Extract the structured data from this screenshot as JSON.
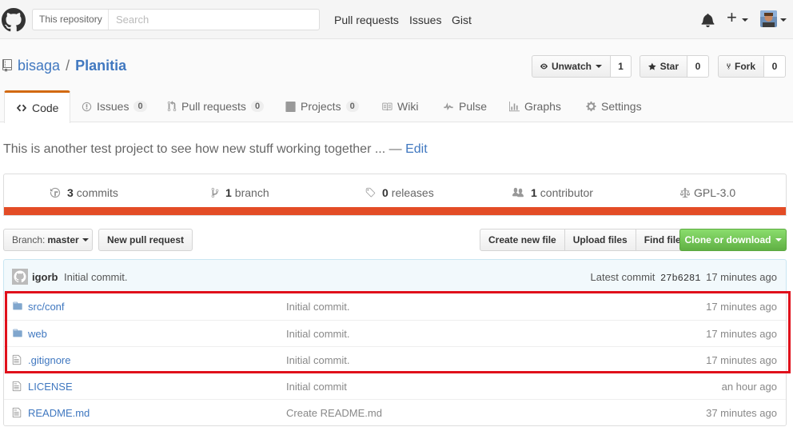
{
  "header": {
    "search_scope": "This repository",
    "search_placeholder": "Search",
    "nav": [
      "Pull requests",
      "Issues",
      "Gist"
    ],
    "icons": [
      "github-logo-icon",
      "bell-icon",
      "plus-icon",
      "avatar"
    ]
  },
  "repo": {
    "owner": "bisaga",
    "separator": "/",
    "name": "Planitia",
    "watch_label": "Unwatch",
    "watch_count": "1",
    "star_label": "Star",
    "star_count": "0",
    "fork_label": "Fork",
    "fork_count": "0"
  },
  "tabs": [
    {
      "label": "Code",
      "counter": null,
      "selected": true
    },
    {
      "label": "Issues",
      "counter": "0"
    },
    {
      "label": "Pull requests",
      "counter": "0"
    },
    {
      "label": "Projects",
      "counter": "0"
    },
    {
      "label": "Wiki",
      "counter": null
    },
    {
      "label": "Pulse",
      "counter": null
    },
    {
      "label": "Graphs",
      "counter": null
    },
    {
      "label": "Settings",
      "counter": null
    }
  ],
  "description": {
    "text": "This is another test project to see how new stuff working together ... —",
    "edit_label": "Edit"
  },
  "summary": {
    "commits_count": "3",
    "commits_label": "commits",
    "branch_count": "1",
    "branch_label": "branch",
    "releases_count": "0",
    "releases_label": "releases",
    "contributor_count": "1",
    "contributor_label": "contributor",
    "license": "GPL-3.0",
    "language_color": "#e34c26"
  },
  "file_nav": {
    "branch_prefix": "Branch:",
    "branch_name": "master",
    "new_pull_request": "New pull request",
    "create_new_file": "Create new file",
    "upload_files": "Upload files",
    "find_file": "Find file",
    "clone_download": "Clone or download"
  },
  "commit_tease": {
    "author": "igorb",
    "message": "Initial commit.",
    "latest_label": "Latest commit",
    "sha": "27b6281",
    "age": "17 minutes ago"
  },
  "files": [
    {
      "type": "dir",
      "name": "src/conf",
      "message": "Initial commit.",
      "age": "17 minutes ago"
    },
    {
      "type": "dir",
      "name": "web",
      "message": "Initial commit.",
      "age": "17 minutes ago"
    },
    {
      "type": "file",
      "name": ".gitignore",
      "message": "Initial commit.",
      "age": "17 minutes ago"
    },
    {
      "type": "file",
      "name": "LICENSE",
      "message": "Initial commit",
      "age": "an hour ago"
    },
    {
      "type": "file",
      "name": "README.md",
      "message": "Create README.md",
      "age": "37 minutes ago"
    }
  ],
  "annotation": {
    "highlight_color": "#e0101b"
  }
}
